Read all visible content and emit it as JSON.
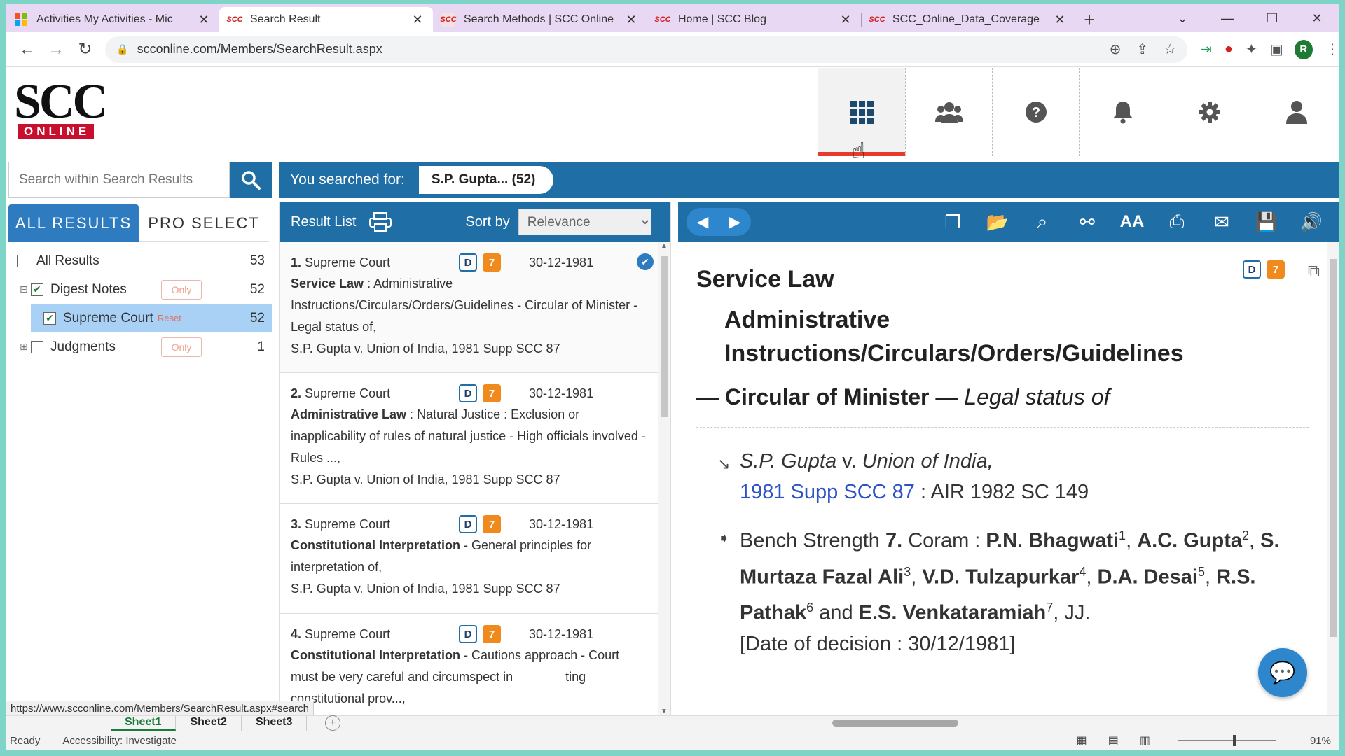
{
  "browser": {
    "tabs": [
      {
        "title": "Activities My Activities - Mic",
        "favicon": "windows-logo"
      },
      {
        "title": "Search Result",
        "favicon": "scc-logo"
      },
      {
        "title": "Search Methods | SCC Online",
        "favicon": "scc-logo"
      },
      {
        "title": "Home | SCC Blog",
        "favicon": "scc-logo"
      },
      {
        "title": "SCC_Online_Data_Coverage",
        "favicon": "scc-logo"
      }
    ],
    "favicon_text": "SCC",
    "active_tab": 1,
    "url": "scconline.com/Members/SearchResult.aspx",
    "profile_initial": "R"
  },
  "site": {
    "logo_main": "SCC",
    "logo_sub": "ONLINE",
    "nav_icons": [
      "apps-grid-icon",
      "users-icon",
      "help-icon",
      "bell-icon",
      "gear-icon",
      "user-icon"
    ]
  },
  "search": {
    "placeholder": "Search within Search Results",
    "you_searched_label": "You searched for:",
    "query_chip": "S.P. Gupta... (52)"
  },
  "filters": {
    "tab_all": "ALL RESULTS",
    "tab_pro": "PRO SELECT",
    "all_results_label": "All Results",
    "all_results_count": "53",
    "digest_label": "Digest Notes",
    "digest_count": "52",
    "only_label": "Only",
    "supreme_label": "Supreme Court",
    "supreme_count": "52",
    "reset_label": "Reset",
    "judgments_label": "Judgments",
    "judgments_count": "1"
  },
  "result_list": {
    "title": "Result List",
    "sort_label": "Sort by",
    "sort_value": "Relevance",
    "badge_d": "D",
    "badge_7": "7",
    "items": [
      {
        "num": "1.",
        "court": "Supreme Court",
        "date": "30-12-1981",
        "head": "Service Law",
        "sep": " : ",
        "body": "Administrative Instructions/Circulars/Orders/Guidelines - Circular of Minister - Legal status of,",
        "cite": "S.P. Gupta v. Union of India, 1981 Supp SCC 87"
      },
      {
        "num": "2.",
        "court": "Supreme Court",
        "date": "30-12-1981",
        "head": "Administrative Law",
        "sep": " : ",
        "body": "Natural Justice : Exclusion or inapplicability of rules of natural justice - High officials involved - Rules ...,",
        "cite": "S.P. Gupta v. Union of India, 1981 Supp SCC 87"
      },
      {
        "num": "3.",
        "court": "Supreme Court",
        "date": "30-12-1981",
        "head": "Constitutional Interpretation",
        "sep": " - ",
        "body": "General principles for interpretation of,",
        "cite": "S.P. Gupta v. Union of India, 1981 Supp SCC 87"
      },
      {
        "num": "4.",
        "court": "Supreme Court",
        "date": "30-12-1981",
        "head": "Constitutional Interpretation",
        "sep": " - ",
        "body": "Cautions approach - Court must be very careful and circumspect in ",
        "body_tail": "ting constitutional prov...,",
        "cite": ""
      }
    ]
  },
  "document": {
    "badge_d": "D",
    "badge_7": "7",
    "heading": "Service Law",
    "subheading": "Administrative Instructions/Circulars/Orders/Guidelines",
    "topic_lead": "— ",
    "topic": "Circular of Minister",
    "topic_dash": " — ",
    "topic_italic": "Legal status of",
    "case_party1": "S.P. Gupta",
    "case_v": " v. ",
    "case_party2": "Union of India,",
    "citation_link": "1981 Supp SCC 87",
    "citation_rest": " : AIR 1982 SC 149",
    "bench_label": "Bench Strength ",
    "bench_num": "7.",
    "coram_label": " Coram : ",
    "judges": [
      {
        "name": "P.N. Bhagwati",
        "sup": "1",
        "after": ", "
      },
      {
        "name": "A.C. Gupta",
        "sup": "2",
        "after": ","
      },
      {
        "name": "S. Murtaza Fazal Ali",
        "sup": "3",
        "after": ", "
      },
      {
        "name": "V.D. Tulzapurkar",
        "sup": "4",
        "after": ", "
      },
      {
        "name": "D.A. Desai",
        "sup": "5",
        "after": ","
      },
      {
        "name": "R.S. Pathak",
        "sup": "6",
        "after": " and "
      },
      {
        "name": "E.S. Venkataramiah",
        "sup": "7",
        "after": ", JJ."
      }
    ],
    "date_line": "[Date of decision : 30/12/1981]"
  },
  "excel": {
    "link_tooltip": "https://www.scconline.com/Members/SearchResult.aspx#search",
    "sheets": [
      "Sheet1",
      "Sheet2",
      "Sheet3"
    ],
    "status": "Ready",
    "accessibility": "Accessibility: Investigate",
    "zoom": "91%"
  },
  "colors": {
    "primary_blue": "#1f6fa6",
    "accent_red": "#e63a2a",
    "badge_orange": "#f08a1c",
    "selected_row": "#a9d1f5"
  }
}
